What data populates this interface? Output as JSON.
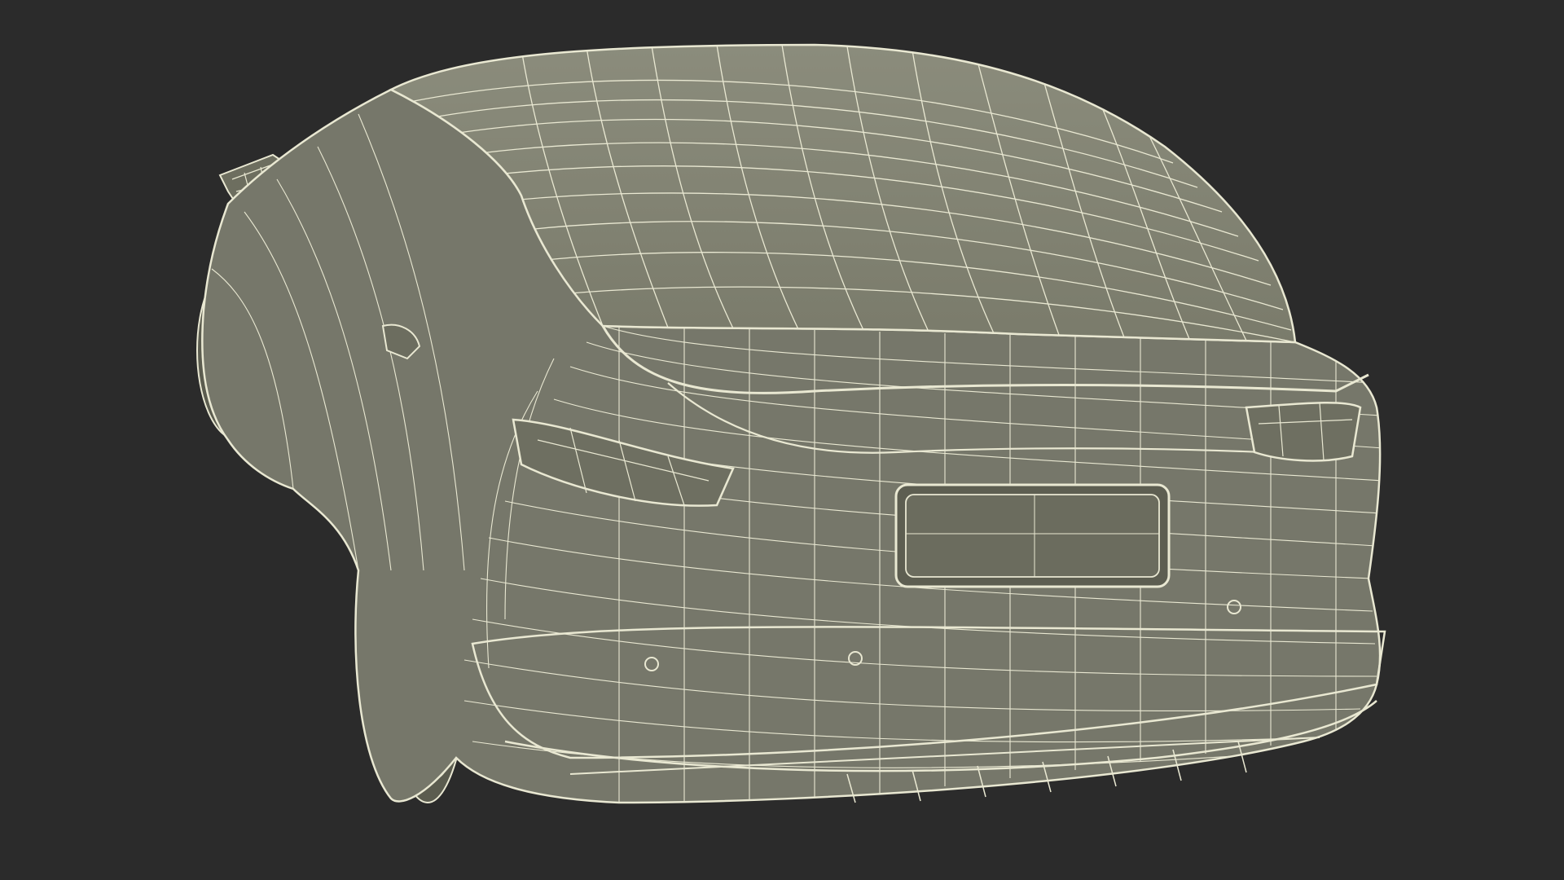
{
  "scene": {
    "subject_icon": "car-wireframe-icon",
    "colors": {
      "background": "#2b2b2b",
      "surface": "#7a7b6c",
      "surface_dark": "#676858",
      "surface_light": "#8a8b7b",
      "wire": "#e9e8d2",
      "plate": "#77786a"
    }
  }
}
